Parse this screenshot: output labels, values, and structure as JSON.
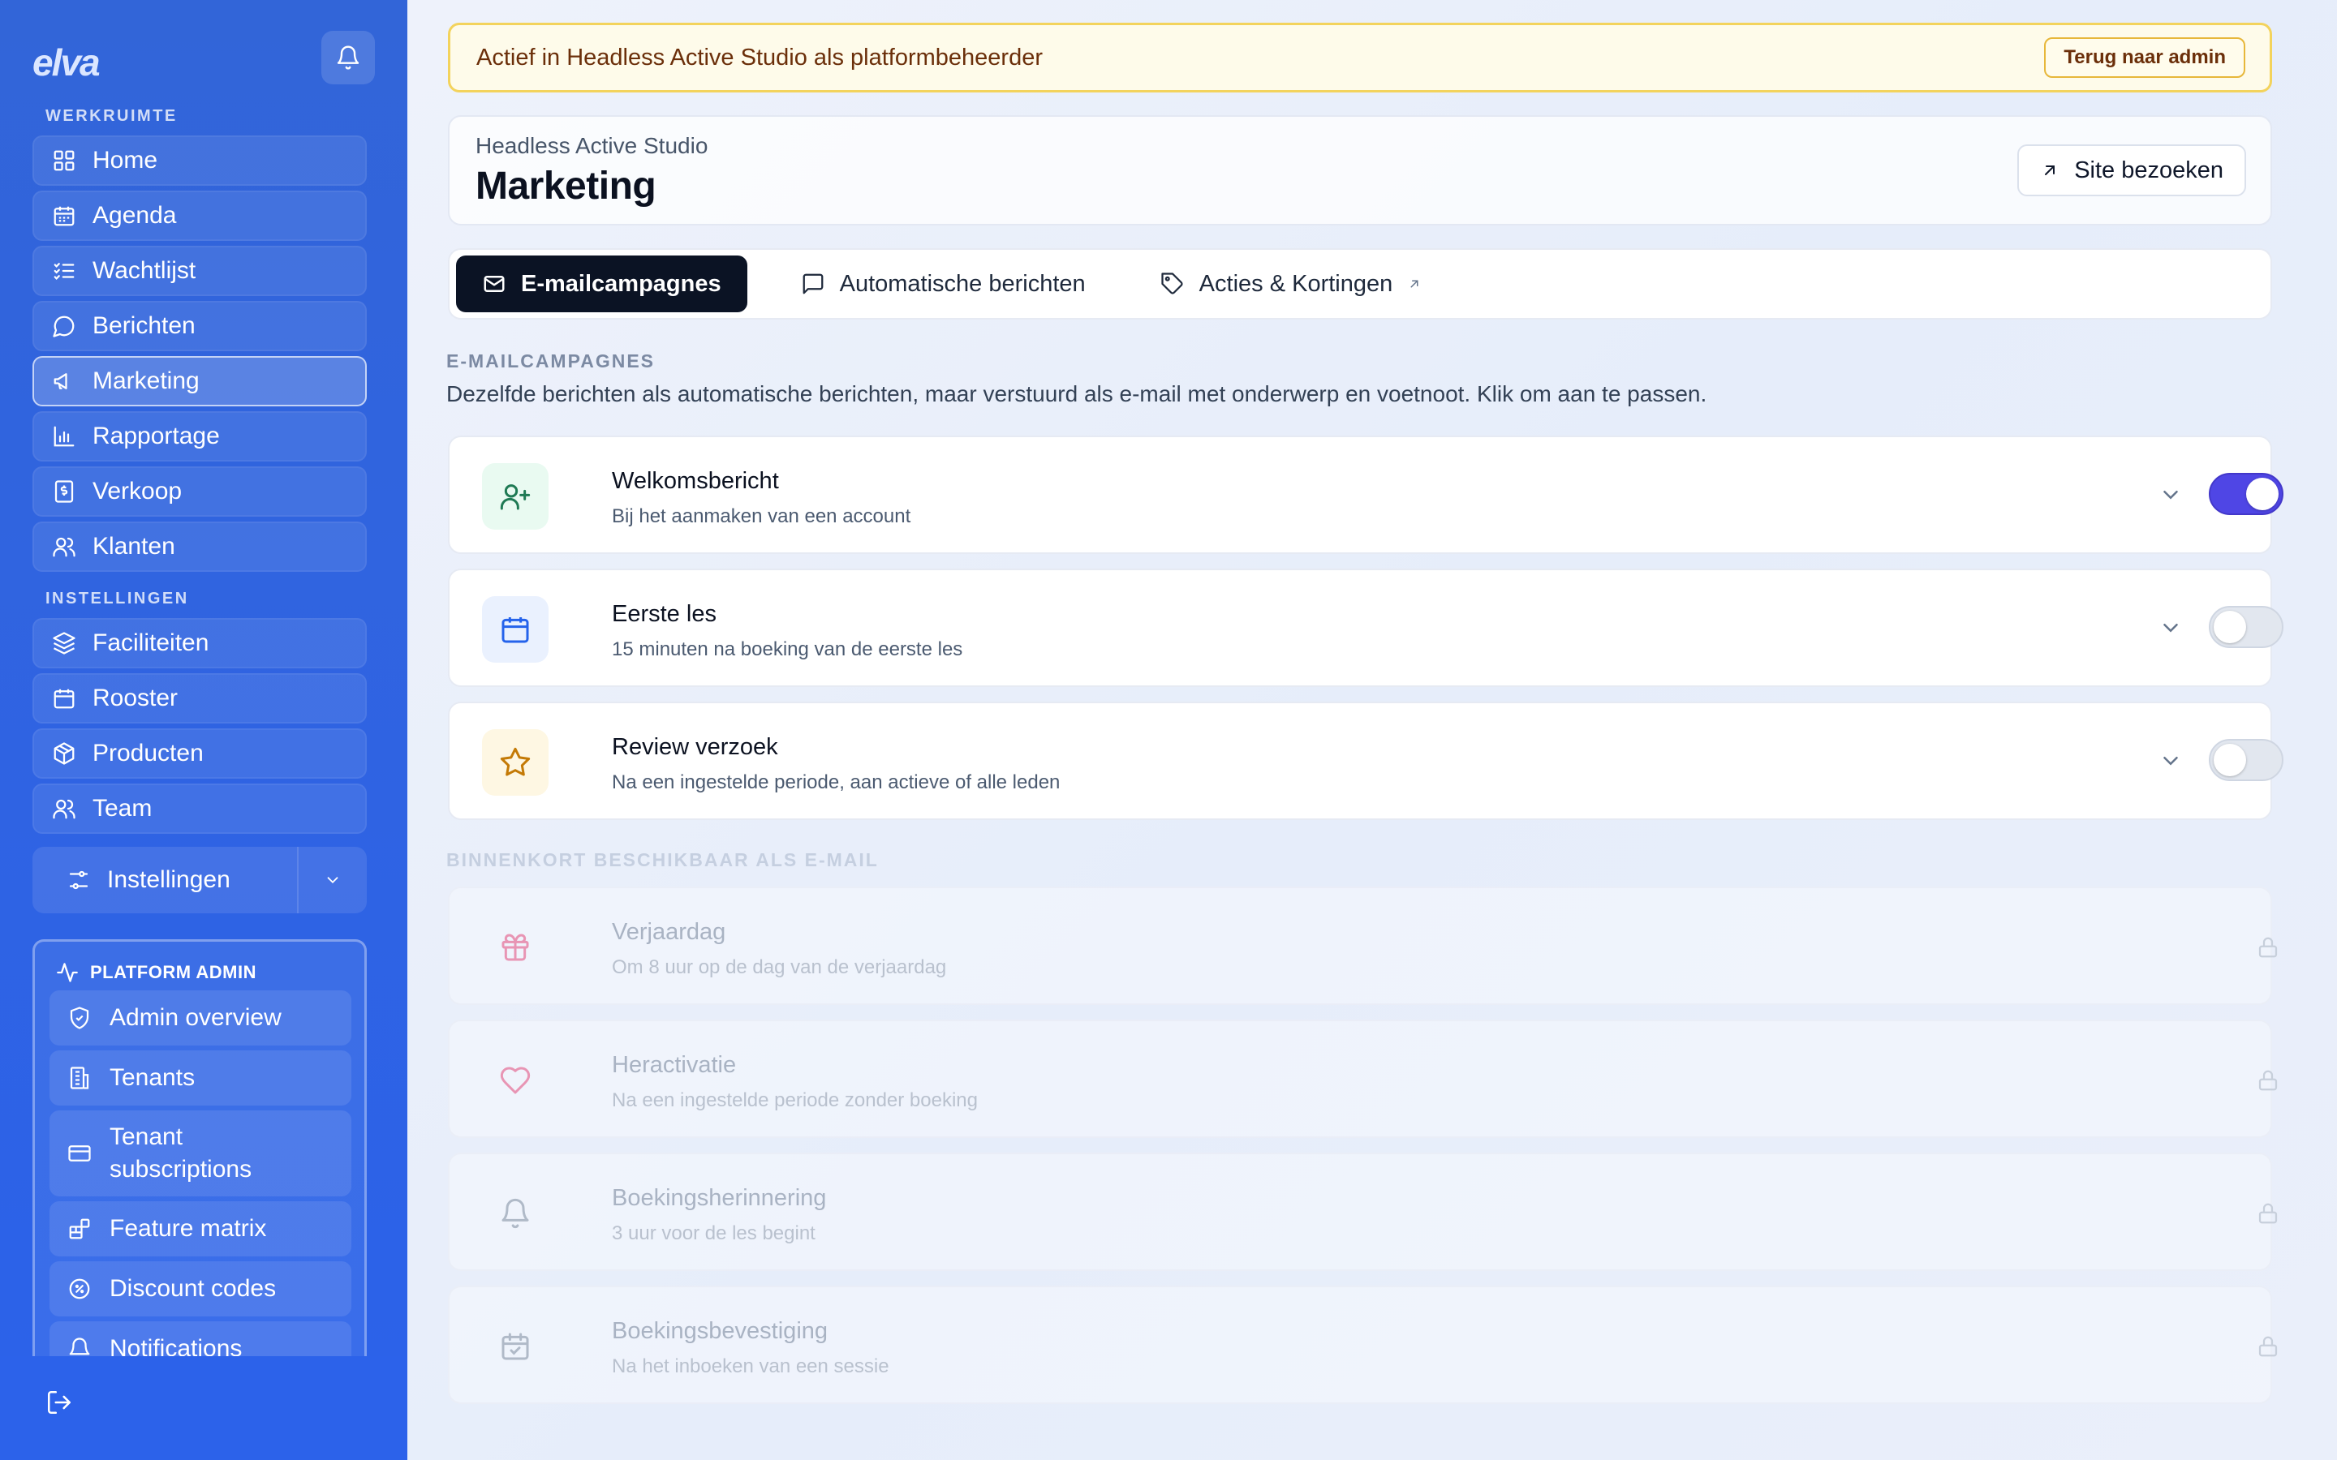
{
  "sidebar": {
    "logo": "elva",
    "workspace_label": "WERKRUIMTE",
    "workspace_items": [
      {
        "label": "Home"
      },
      {
        "label": "Agenda"
      },
      {
        "label": "Wachtlijst"
      },
      {
        "label": "Berichten"
      },
      {
        "label": "Marketing",
        "active": true
      },
      {
        "label": "Rapportage"
      },
      {
        "label": "Verkoop"
      },
      {
        "label": "Klanten"
      }
    ],
    "settings_label": "INSTELLINGEN",
    "settings_items": [
      {
        "label": "Faciliteiten"
      },
      {
        "label": "Rooster"
      },
      {
        "label": "Producten"
      },
      {
        "label": "Team"
      }
    ],
    "settings_toggle": "Instellingen",
    "platform_admin": {
      "title": "PLATFORM ADMIN",
      "items": [
        {
          "label": "Admin overview"
        },
        {
          "label": "Tenants"
        },
        {
          "label": "Tenant subscriptions"
        },
        {
          "label": "Feature matrix"
        },
        {
          "label": "Discount codes"
        },
        {
          "label": "Notifications"
        }
      ]
    }
  },
  "banner": {
    "text": "Actief in Headless Active Studio als platformbeheerder",
    "button": "Terug naar admin"
  },
  "header": {
    "workspace": "Headless Active Studio",
    "title": "Marketing",
    "visit_button": "Site bezoeken"
  },
  "tabs": [
    {
      "label": "E-mailcampagnes",
      "active": true
    },
    {
      "label": "Automatische berichten"
    },
    {
      "label": "Acties & Kortingen"
    }
  ],
  "campaigns": {
    "section_title": "E-MAILCAMPAGNES",
    "description": "Dezelfde berichten als automatische berichten, maar verstuurd als e-mail met onderwerp en voetnoot. Klik om aan te passen.",
    "items": [
      {
        "title": "Welkomsbericht",
        "subtitle": "Bij het aanmaken van een account",
        "enabled": true,
        "icon": "user-plus-icon"
      },
      {
        "title": "Eerste les",
        "subtitle": "15 minuten na boeking van de eerste les",
        "enabled": false,
        "icon": "calendar-icon"
      },
      {
        "title": "Review verzoek",
        "subtitle": "Na een ingestelde periode, aan actieve of alle leden",
        "enabled": false,
        "icon": "star-icon"
      }
    ]
  },
  "coming_soon": {
    "section_title": "BINNENKORT BESCHIKBAAR ALS E-MAIL",
    "items": [
      {
        "title": "Verjaardag",
        "subtitle": "Om 8 uur op de dag van de verjaardag",
        "icon": "gift-icon"
      },
      {
        "title": "Heractivatie",
        "subtitle": "Na een ingestelde periode zonder boeking",
        "icon": "heart-icon"
      },
      {
        "title": "Boekingsherinnering",
        "subtitle": "3 uur voor de les begint",
        "icon": "bell-icon"
      },
      {
        "title": "Boekingsbevestiging",
        "subtitle": "Na het inboeken van een sessie",
        "icon": "calendar-check-icon"
      }
    ]
  },
  "colors": {
    "sidebar": "#2f63e3",
    "toggle_on": "#4f46e5",
    "banner_bg": "#fefbea",
    "banner_border": "#f3d35c",
    "active_tab": "#0b1324"
  }
}
